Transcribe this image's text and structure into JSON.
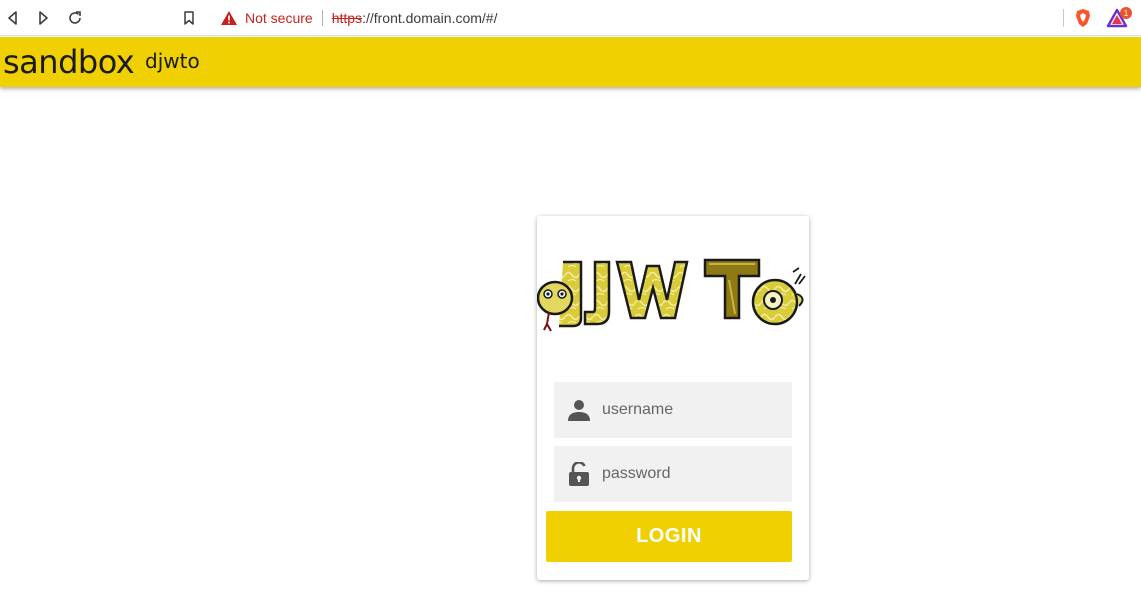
{
  "browser": {
    "security_label": "Not secure",
    "url_scheme": "https",
    "url_rest": "://front.domain.com/#/",
    "rewards_count": "1"
  },
  "header": {
    "title": "sandbox",
    "subtitle": "djwto"
  },
  "login": {
    "logo_text": "djwto",
    "username_placeholder": "username",
    "password_placeholder": "password",
    "login_label": "LOGIN"
  },
  "colors": {
    "accent": "#f0d000",
    "field_bg": "#f1f1f1",
    "warning": "#c5221f"
  },
  "icons": {
    "back": "back-icon",
    "forward": "forward-icon",
    "reload": "reload-icon",
    "bookmark": "bookmark-icon",
    "warning": "warning-icon",
    "brave": "brave-shield-icon",
    "rewards": "rewards-icon",
    "user": "user-icon",
    "lock": "lock-open-icon"
  }
}
